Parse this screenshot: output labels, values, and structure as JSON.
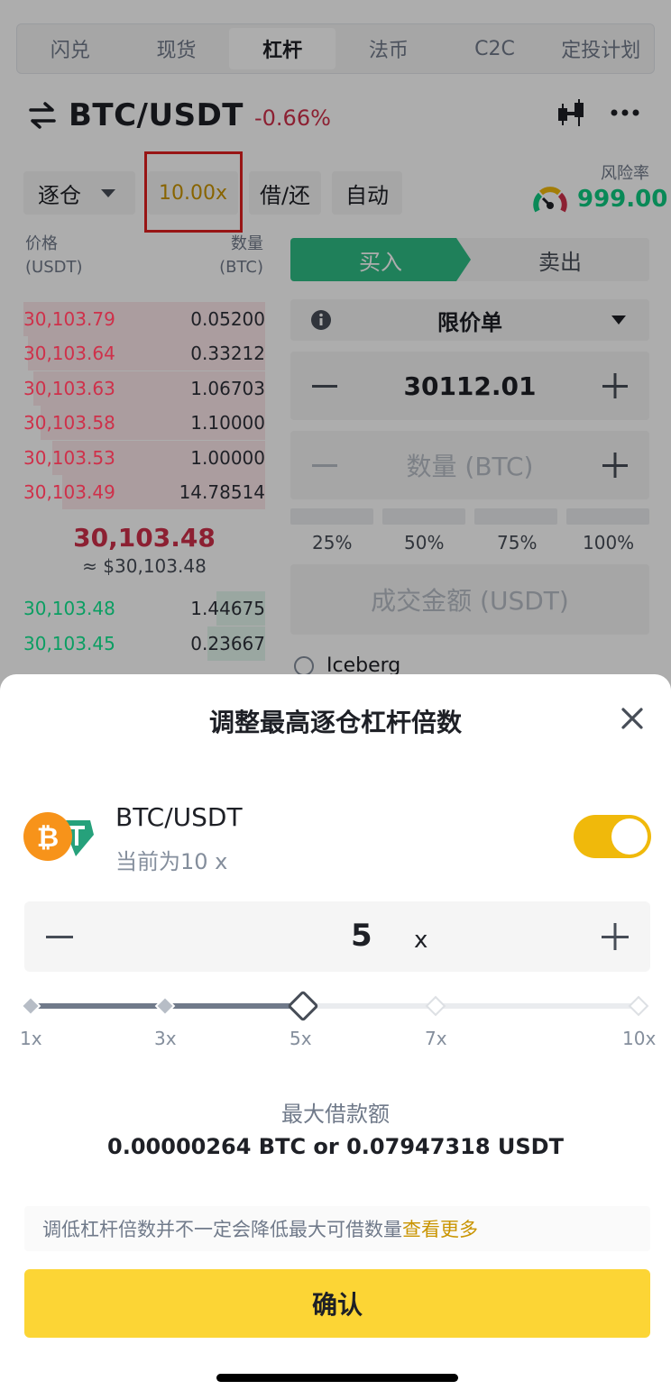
{
  "tabs": [
    "闪兑",
    "现货",
    "杠杆",
    "法币",
    "C2C",
    "定投计划"
  ],
  "active_tab": "杠杆",
  "pair": {
    "title": "BTC/USDT",
    "change": "-0.66%"
  },
  "controls": {
    "margin_mode": "逐仓",
    "leverage": "10.00x",
    "borrow_repay": "借/还",
    "auto": "自动"
  },
  "risk": {
    "label": "风险率",
    "value": "999.00"
  },
  "orderbook": {
    "price_header": "价格",
    "price_unit": "(USDT)",
    "qty_header": "数量",
    "qty_unit": "(BTC)",
    "asks": [
      {
        "price": "30,103.79",
        "qty": "0.05200"
      },
      {
        "price": "30,103.64",
        "qty": "0.33212"
      },
      {
        "price": "30,103.63",
        "qty": "1.06703"
      },
      {
        "price": "30,103.58",
        "qty": "1.10000"
      },
      {
        "price": "30,103.53",
        "qty": "1.00000"
      },
      {
        "price": "30,103.49",
        "qty": "14.78514"
      }
    ],
    "mid_price": "30,103.48",
    "mid_fiat": "≈ $30,103.48",
    "bids": [
      {
        "price": "30,103.48",
        "qty": "1.44675"
      },
      {
        "price": "30,103.45",
        "qty": "0.23667"
      }
    ]
  },
  "form": {
    "buy": "买入",
    "sell": "卖出",
    "order_type": "限价单",
    "price": "30112.01",
    "qty_placeholder": "数量 (BTC)",
    "percents": [
      "25%",
      "50%",
      "75%",
      "100%"
    ],
    "amount_placeholder": "成交金额 (USDT)",
    "iceberg": "Iceberg"
  },
  "modal": {
    "title": "调整最高逐仓杠杆倍数",
    "pair": "BTC/USDT",
    "current": "当前为10 x",
    "toggle_on": true,
    "value": "5",
    "unit": "x",
    "slider_marks": [
      "1x",
      "3x",
      "5x",
      "7x",
      "10x"
    ],
    "slider_selected": "5x",
    "max_borrow_label": "最大借款额",
    "max_borrow_value": "0.00000264 BTC or 0.07947318 USDT",
    "notice": "调低杠杆倍数并不一定会降低最大可借数量",
    "notice_link": "查看更多",
    "confirm": "确认"
  },
  "colors": {
    "accent": "#f0b90b",
    "confirm": "#fcd535",
    "up": "#2ebd85",
    "down": "#cf304a",
    "highlight": "#e02020"
  }
}
